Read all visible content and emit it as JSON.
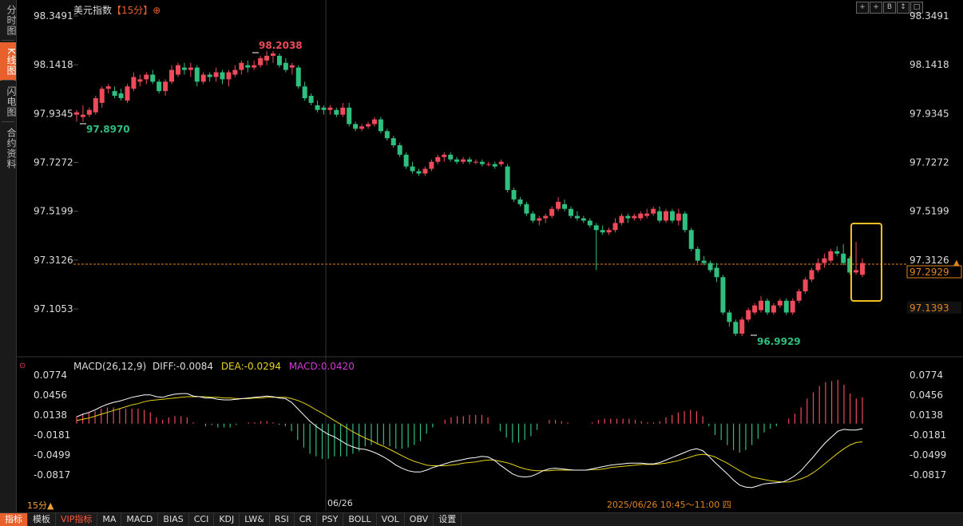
{
  "sidebar": {
    "tabs": [
      {
        "label": "分时图",
        "active": false
      },
      {
        "label": "K线图",
        "active": true
      },
      {
        "label": "闪电图",
        "active": false
      },
      {
        "label": "合约资料",
        "active": false
      }
    ]
  },
  "header": {
    "title": "美元指数",
    "period": "【15分】",
    "settings_glyph": "⊕",
    "window_buttons": [
      "+",
      "+",
      "B",
      "↕",
      "□"
    ]
  },
  "price_axis": {
    "ticks": [
      "98.3491",
      "98.1418",
      "97.9345",
      "97.7272",
      "97.5199",
      "97.3126",
      "97.1053"
    ],
    "current_price": "97.2929",
    "crosshair_price": "97.1393",
    "dashed_level": "97.3126"
  },
  "annotations": {
    "high": "98.2038",
    "low_left": "97.8970",
    "low": "96.9929"
  },
  "macd": {
    "label": "MACD(26,12,9)",
    "diff_text": "DIFF:-0.0084",
    "dea_text": "DEA:-0.0294",
    "macd_text": "MACD:0.0420",
    "ticks": [
      "0.0774",
      "0.0456",
      "0.0138",
      "-0.0181",
      "-0.0499",
      "-0.0817"
    ]
  },
  "footer": {
    "period_indicator": "15分▲",
    "date_label": "06/26",
    "time_range": "2025/06/26 10:45～11:00 四",
    "tabs": [
      {
        "label": "指标",
        "active": true
      },
      {
        "label": "模板",
        "active": false
      },
      {
        "label": "VIP指标",
        "active": false,
        "vip": true
      },
      {
        "label": "MA",
        "active": false
      },
      {
        "label": "MACD",
        "active": false
      },
      {
        "label": "BIAS",
        "active": false
      },
      {
        "label": "CCI",
        "active": false
      },
      {
        "label": "KDJ",
        "active": false
      },
      {
        "label": "LW&",
        "active": false
      },
      {
        "label": "RSI",
        "active": false
      },
      {
        "label": "CR",
        "active": false
      },
      {
        "label": "PSY",
        "active": false
      },
      {
        "label": "BOLL",
        "active": false
      },
      {
        "label": "VOL",
        "active": false
      },
      {
        "label": "OBV",
        "active": false
      },
      {
        "label": "设置",
        "active": false
      }
    ]
  },
  "colors": {
    "up": "#ee4a5a",
    "down": "#2fbf7f",
    "accent": "#e8612c",
    "dashed_line": "#e0851c",
    "diff_line": "#ffffff",
    "dea_line": "#e6d21a",
    "macd_text": "#d23ad2",
    "highlight_box": "#f0c020"
  },
  "chart_data": {
    "type": "candlestick",
    "instrument": "美元指数",
    "interval": "15分",
    "price_range": [
      96.96,
      98.36
    ],
    "candles": [
      [
        97.93,
        97.95,
        97.9,
        97.94
      ],
      [
        97.92,
        97.97,
        97.9,
        97.93
      ],
      [
        97.93,
        97.96,
        97.92,
        97.95
      ],
      [
        97.94,
        98.01,
        97.93,
        98.0
      ],
      [
        97.98,
        98.05,
        97.96,
        98.04
      ],
      [
        98.04,
        98.06,
        98.02,
        98.05
      ],
      [
        98.03,
        98.05,
        98.0,
        98.01
      ],
      [
        98.02,
        98.04,
        97.99,
        98.0
      ],
      [
        97.99,
        98.06,
        97.98,
        98.05
      ],
      [
        98.04,
        98.11,
        98.03,
        98.09
      ],
      [
        98.07,
        98.1,
        98.05,
        98.08
      ],
      [
        98.08,
        98.11,
        98.06,
        98.1
      ],
      [
        98.1,
        98.12,
        98.06,
        98.07
      ],
      [
        98.07,
        98.08,
        98.02,
        98.03
      ],
      [
        98.03,
        98.08,
        98.01,
        98.07
      ],
      [
        98.07,
        98.14,
        98.06,
        98.12
      ],
      [
        98.1,
        98.15,
        98.09,
        98.14
      ],
      [
        98.13,
        98.15,
        98.1,
        98.12
      ],
      [
        98.12,
        98.15,
        98.09,
        98.13
      ],
      [
        98.13,
        98.14,
        98.05,
        98.07
      ],
      [
        98.07,
        98.11,
        98.06,
        98.1
      ],
      [
        98.1,
        98.11,
        98.07,
        98.09
      ],
      [
        98.09,
        98.13,
        98.07,
        98.11
      ],
      [
        98.11,
        98.12,
        98.06,
        98.08
      ],
      [
        98.08,
        98.12,
        98.05,
        98.11
      ],
      [
        98.1,
        98.14,
        98.09,
        98.12
      ],
      [
        98.12,
        98.16,
        98.1,
        98.15
      ],
      [
        98.14,
        98.16,
        98.11,
        98.13
      ],
      [
        98.13,
        98.16,
        98.12,
        98.14
      ],
      [
        98.14,
        98.18,
        98.13,
        98.17
      ],
      [
        98.16,
        98.2,
        98.14,
        98.18
      ],
      [
        98.18,
        98.2,
        98.15,
        98.19
      ],
      [
        98.18,
        98.19,
        98.13,
        98.14
      ],
      [
        98.15,
        98.17,
        98.11,
        98.12
      ],
      [
        98.13,
        98.15,
        98.1,
        98.14
      ],
      [
        98.13,
        98.14,
        98.04,
        98.05
      ],
      [
        98.05,
        98.07,
        97.99,
        98.0
      ],
      [
        98.01,
        98.02,
        97.97,
        97.98
      ],
      [
        97.97,
        97.99,
        97.94,
        97.95
      ],
      [
        97.96,
        97.97,
        97.93,
        97.95
      ],
      [
        97.95,
        97.97,
        97.93,
        97.96
      ],
      [
        97.95,
        97.96,
        97.92,
        97.93
      ],
      [
        97.93,
        97.98,
        97.92,
        97.96
      ],
      [
        97.96,
        97.98,
        97.88,
        97.89
      ],
      [
        97.89,
        97.9,
        97.86,
        97.87
      ],
      [
        97.87,
        97.89,
        97.86,
        97.88
      ],
      [
        97.88,
        97.9,
        97.87,
        97.89
      ],
      [
        97.89,
        97.92,
        97.88,
        97.91
      ],
      [
        97.91,
        97.92,
        97.85,
        97.86
      ],
      [
        97.86,
        97.87,
        97.82,
        97.83
      ],
      [
        97.83,
        97.84,
        97.79,
        97.8
      ],
      [
        97.8,
        97.81,
        97.75,
        97.76
      ],
      [
        97.76,
        97.77,
        97.7,
        97.71
      ],
      [
        97.71,
        97.73,
        97.68,
        97.69
      ],
      [
        97.69,
        97.7,
        97.67,
        97.68
      ],
      [
        97.68,
        97.71,
        97.67,
        97.7
      ],
      [
        97.7,
        97.74,
        97.69,
        97.73
      ],
      [
        97.73,
        97.76,
        97.72,
        97.75
      ],
      [
        97.75,
        97.77,
        97.73,
        97.76
      ],
      [
        97.76,
        97.77,
        97.73,
        97.74
      ],
      [
        97.74,
        97.75,
        97.72,
        97.73
      ],
      [
        97.73,
        97.75,
        97.72,
        97.74
      ],
      [
        97.74,
        97.75,
        97.72,
        97.73
      ],
      [
        97.73,
        97.74,
        97.72,
        97.73
      ],
      [
        97.73,
        97.74,
        97.71,
        97.72
      ],
      [
        97.72,
        97.73,
        97.71,
        97.72
      ],
      [
        97.72,
        97.73,
        97.7,
        97.71
      ],
      [
        97.72,
        97.74,
        97.71,
        97.73
      ],
      [
        97.71,
        97.72,
        97.6,
        97.61
      ],
      [
        97.61,
        97.62,
        97.56,
        97.57
      ],
      [
        97.57,
        97.58,
        97.54,
        97.55
      ],
      [
        97.55,
        97.56,
        97.5,
        97.51
      ],
      [
        97.51,
        97.52,
        97.47,
        97.48
      ],
      [
        97.48,
        97.5,
        97.46,
        97.49
      ],
      [
        97.49,
        97.51,
        97.47,
        97.5
      ],
      [
        97.5,
        97.54,
        97.49,
        97.53
      ],
      [
        97.53,
        97.58,
        97.52,
        97.56
      ],
      [
        97.55,
        97.57,
        97.52,
        97.53
      ],
      [
        97.53,
        97.54,
        97.49,
        97.5
      ],
      [
        97.5,
        97.52,
        97.48,
        97.49
      ],
      [
        97.49,
        97.5,
        97.47,
        97.48
      ],
      [
        97.48,
        97.49,
        97.45,
        97.46
      ],
      [
        97.46,
        97.47,
        97.27,
        97.44
      ],
      [
        97.44,
        97.46,
        97.42,
        97.43
      ],
      [
        97.43,
        97.45,
        97.42,
        97.44
      ],
      [
        97.44,
        97.49,
        97.43,
        97.47
      ],
      [
        97.47,
        97.51,
        97.46,
        97.5
      ],
      [
        97.5,
        97.51,
        97.47,
        97.49
      ],
      [
        97.49,
        97.51,
        97.48,
        97.5
      ],
      [
        97.49,
        97.52,
        97.48,
        97.51
      ],
      [
        97.5,
        97.53,
        97.49,
        97.51
      ],
      [
        97.51,
        97.54,
        97.5,
        97.53
      ],
      [
        97.52,
        97.54,
        97.47,
        97.48
      ],
      [
        97.48,
        97.53,
        97.47,
        97.52
      ],
      [
        97.52,
        97.53,
        97.47,
        97.48
      ],
      [
        97.48,
        97.53,
        97.46,
        97.51
      ],
      [
        97.51,
        97.52,
        97.43,
        97.44
      ],
      [
        97.44,
        97.45,
        97.35,
        97.36
      ],
      [
        97.36,
        97.37,
        97.3,
        97.31
      ],
      [
        97.31,
        97.33,
        97.29,
        97.3
      ],
      [
        97.3,
        97.31,
        97.26,
        97.27
      ],
      [
        97.28,
        97.3,
        97.22,
        97.24
      ],
      [
        97.24,
        97.25,
        97.08,
        97.09
      ],
      [
        97.09,
        97.1,
        97.03,
        97.05
      ],
      [
        97.05,
        97.06,
        96.99,
        97.0
      ],
      [
        97.0,
        97.07,
        96.99,
        97.06
      ],
      [
        97.06,
        97.11,
        97.05,
        97.1
      ],
      [
        97.09,
        97.13,
        97.08,
        97.12
      ],
      [
        97.1,
        97.16,
        97.09,
        97.14
      ],
      [
        97.14,
        97.15,
        97.08,
        97.09
      ],
      [
        97.09,
        97.13,
        97.08,
        97.12
      ],
      [
        97.12,
        97.15,
        97.11,
        97.14
      ],
      [
        97.14,
        97.15,
        97.08,
        97.09
      ],
      [
        97.09,
        97.15,
        97.08,
        97.14
      ],
      [
        97.14,
        97.19,
        97.13,
        97.18
      ],
      [
        97.18,
        97.24,
        97.17,
        97.23
      ],
      [
        97.23,
        97.28,
        97.22,
        97.27
      ],
      [
        97.27,
        97.32,
        97.26,
        97.3
      ],
      [
        97.3,
        97.34,
        97.28,
        97.32
      ],
      [
        97.31,
        97.36,
        97.3,
        97.35
      ],
      [
        97.35,
        97.37,
        97.33,
        97.34
      ],
      [
        97.34,
        97.38,
        97.29,
        97.3
      ],
      [
        97.32,
        97.33,
        97.25,
        97.26
      ],
      [
        97.26,
        97.39,
        97.25,
        97.27
      ],
      [
        97.25,
        97.32,
        97.24,
        97.3
      ]
    ],
    "macd_diff": [
      0.011,
      0.015,
      0.018,
      0.022,
      0.027,
      0.031,
      0.034,
      0.036,
      0.039,
      0.042,
      0.044,
      0.046,
      0.046,
      0.043,
      0.042,
      0.045,
      0.047,
      0.048,
      0.048,
      0.044,
      0.043,
      0.041,
      0.041,
      0.039,
      0.038,
      0.038,
      0.039,
      0.04,
      0.041,
      0.042,
      0.043,
      0.044,
      0.043,
      0.041,
      0.04,
      0.034,
      0.024,
      0.014,
      0.004,
      -0.004,
      -0.011,
      -0.017,
      -0.021,
      -0.027,
      -0.033,
      -0.037,
      -0.04,
      -0.041,
      -0.044,
      -0.048,
      -0.053,
      -0.059,
      -0.066,
      -0.071,
      -0.075,
      -0.077,
      -0.077,
      -0.074,
      -0.07,
      -0.067,
      -0.064,
      -0.061,
      -0.059,
      -0.057,
      -0.055,
      -0.054,
      -0.052,
      -0.053,
      -0.058,
      -0.066,
      -0.073,
      -0.08,
      -0.084,
      -0.085,
      -0.084,
      -0.08,
      -0.075,
      -0.072,
      -0.071,
      -0.072,
      -0.073,
      -0.074,
      -0.074,
      -0.074,
      -0.072,
      -0.07,
      -0.068,
      -0.066,
      -0.065,
      -0.064,
      -0.063,
      -0.063,
      -0.063,
      -0.064,
      -0.064,
      -0.062,
      -0.058,
      -0.054,
      -0.05,
      -0.046,
      -0.042,
      -0.04,
      -0.043,
      -0.052,
      -0.062,
      -0.071,
      -0.08,
      -0.09,
      -0.098,
      -0.101,
      -0.102,
      -0.099,
      -0.096,
      -0.095,
      -0.094,
      -0.093,
      -0.089,
      -0.083,
      -0.075,
      -0.064,
      -0.053,
      -0.041,
      -0.03,
      -0.021,
      -0.012,
      -0.009,
      -0.01,
      -0.01,
      -0.008
    ],
    "macd_dea": [
      0.005,
      0.007,
      0.009,
      0.012,
      0.015,
      0.018,
      0.021,
      0.024,
      0.027,
      0.03,
      0.032,
      0.035,
      0.037,
      0.038,
      0.039,
      0.04,
      0.041,
      0.042,
      0.043,
      0.043,
      0.043,
      0.043,
      0.042,
      0.042,
      0.041,
      0.041,
      0.04,
      0.04,
      0.04,
      0.041,
      0.041,
      0.042,
      0.042,
      0.042,
      0.042,
      0.04,
      0.037,
      0.033,
      0.028,
      0.022,
      0.017,
      0.011,
      0.005,
      -0.001,
      -0.007,
      -0.013,
      -0.018,
      -0.023,
      -0.027,
      -0.032,
      -0.036,
      -0.041,
      -0.046,
      -0.051,
      -0.056,
      -0.06,
      -0.063,
      -0.066,
      -0.067,
      -0.067,
      -0.067,
      -0.066,
      -0.065,
      -0.063,
      -0.062,
      -0.061,
      -0.059,
      -0.058,
      -0.058,
      -0.06,
      -0.062,
      -0.065,
      -0.069,
      -0.072,
      -0.074,
      -0.075,
      -0.075,
      -0.075,
      -0.074,
      -0.074,
      -0.074,
      -0.074,
      -0.074,
      -0.074,
      -0.073,
      -0.073,
      -0.072,
      -0.07,
      -0.069,
      -0.068,
      -0.067,
      -0.066,
      -0.065,
      -0.065,
      -0.065,
      -0.064,
      -0.063,
      -0.061,
      -0.059,
      -0.056,
      -0.053,
      -0.05,
      -0.049,
      -0.05,
      -0.053,
      -0.058,
      -0.063,
      -0.069,
      -0.075,
      -0.08,
      -0.085,
      -0.087,
      -0.089,
      -0.091,
      -0.092,
      -0.093,
      -0.093,
      -0.091,
      -0.088,
      -0.084,
      -0.078,
      -0.071,
      -0.063,
      -0.055,
      -0.047,
      -0.04,
      -0.034,
      -0.03,
      -0.029
    ]
  }
}
